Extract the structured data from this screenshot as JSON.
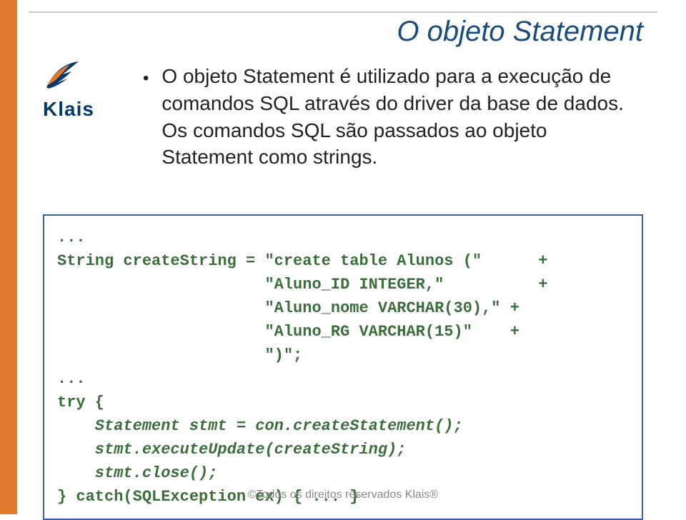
{
  "title": "O objeto Statement",
  "logo": {
    "name": "Klais"
  },
  "bullet": {
    "text": "O objeto Statement é utilizado para a execução de comandos SQL através do driver da base de dados. Os comandos SQL são passados ao objeto Statement como  strings."
  },
  "code": {
    "line1": "...",
    "line2": "String createString = \"create table Alunos (\"      +",
    "line3": "                      \"Aluno_ID INTEGER,\"          +",
    "line4": "                      \"Aluno_nome VARCHAR(30),\" +",
    "line5": "                      \"Aluno_RG VARCHAR(15)\"    +",
    "line6": "                      \")\";",
    "line7": "...",
    "line8": "try {",
    "line9": "    Statement stmt = con.createStatement();",
    "line10": "    stmt.executeUpdate(createString);",
    "line11": "    stmt.close();",
    "line12": "} catch(SQLException ex) { ... }"
  },
  "footer": "©Todos os direitos reservados Klais®"
}
